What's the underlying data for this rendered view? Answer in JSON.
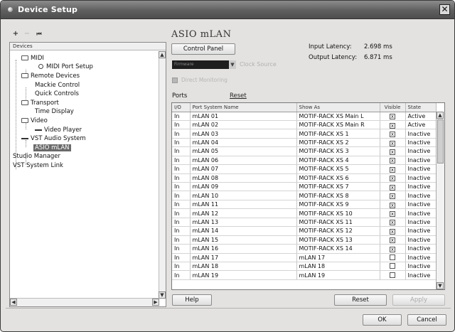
{
  "window": {
    "title": "Device Setup",
    "close": "✕"
  },
  "toolbar": {
    "add": "+",
    "remove": "−",
    "reset": "⏮"
  },
  "tree": {
    "header": "Devices",
    "items": [
      {
        "label": "MIDI",
        "icon": "folder-icon"
      },
      {
        "label": "MIDI Port Setup",
        "icon": "circle-icon"
      },
      {
        "label": "Remote Devices",
        "icon": "folder-icon"
      },
      {
        "label": "Mackie Control",
        "icon": ""
      },
      {
        "label": "Quick Controls",
        "icon": ""
      },
      {
        "label": "Transport",
        "icon": "folder-icon"
      },
      {
        "label": "Time Display",
        "icon": ""
      },
      {
        "label": "Video",
        "icon": "folder-icon"
      },
      {
        "label": "Video Player",
        "icon": "video-icon"
      },
      {
        "label": "VST Audio System",
        "icon": "vst-icon"
      },
      {
        "label": "ASIO mLAN",
        "icon": ""
      },
      {
        "label": "Studio Manager",
        "icon": ""
      },
      {
        "label": "VST System Link",
        "icon": ""
      }
    ]
  },
  "panel": {
    "title": "ASIO mLAN",
    "control_panel": "Control Panel",
    "input_latency_label": "Input Latency:",
    "input_latency_value": "2.698 ms",
    "output_latency_label": "Output Latency:",
    "output_latency_value": "6.871 ms",
    "clock_source_value": "Firmware",
    "clock_source_label": "Clock Source",
    "direct_monitoring": "Direct Monitoring",
    "ports_label": "Ports",
    "reset_link": "Reset"
  },
  "table": {
    "headers": [
      "I/O",
      "Port System Name",
      "Show As",
      "Visible",
      "State"
    ],
    "rows": [
      [
        "In",
        "mLAN 01",
        "MOTIF-RACK XS Main L",
        "x",
        "Active"
      ],
      [
        "In",
        "mLAN 02",
        "MOTIF-RACK XS Main R",
        "x",
        "Active"
      ],
      [
        "In",
        "mLAN 03",
        "MOTIF-RACK XS 1",
        "x",
        "Inactive"
      ],
      [
        "In",
        "mLAN 04",
        "MOTIF-RACK XS 2",
        "x",
        "Inactive"
      ],
      [
        "In",
        "mLAN 05",
        "MOTIF-RACK XS 3",
        "x",
        "Inactive"
      ],
      [
        "In",
        "mLAN 06",
        "MOTIF-RACK XS 4",
        "x",
        "Inactive"
      ],
      [
        "In",
        "mLAN 07",
        "MOTIF-RACK XS 5",
        "x",
        "Inactive"
      ],
      [
        "In",
        "mLAN 08",
        "MOTIF-RACK XS 6",
        "x",
        "Inactive"
      ],
      [
        "In",
        "mLAN 09",
        "MOTIF-RACK XS 7",
        "x",
        "Inactive"
      ],
      [
        "In",
        "mLAN 10",
        "MOTIF-RACK XS 8",
        "x",
        "Inactive"
      ],
      [
        "In",
        "mLAN 11",
        "MOTIF-RACK XS 9",
        "x",
        "Inactive"
      ],
      [
        "In",
        "mLAN 12",
        "MOTIF-RACK XS 10",
        "x",
        "Inactive"
      ],
      [
        "In",
        "mLAN 13",
        "MOTIF-RACK XS 11",
        "x",
        "Inactive"
      ],
      [
        "In",
        "mLAN 14",
        "MOTIF-RACK XS 12",
        "x",
        "Inactive"
      ],
      [
        "In",
        "mLAN 15",
        "MOTIF-RACK XS 13",
        "x",
        "Inactive"
      ],
      [
        "In",
        "mLAN 16",
        "MOTIF-RACK XS 14",
        "x",
        "Inactive"
      ],
      [
        "In",
        "mLAN 17",
        "mLAN 17",
        "",
        "Inactive"
      ],
      [
        "In",
        "mLAN 18",
        "mLAN 18",
        "",
        "Inactive"
      ],
      [
        "In",
        "mLAN 19",
        "mLAN 19",
        "",
        "Inactive"
      ]
    ]
  },
  "buttons": {
    "help": "Help",
    "reset": "Reset",
    "apply": "Apply",
    "ok": "OK",
    "cancel": "Cancel"
  }
}
